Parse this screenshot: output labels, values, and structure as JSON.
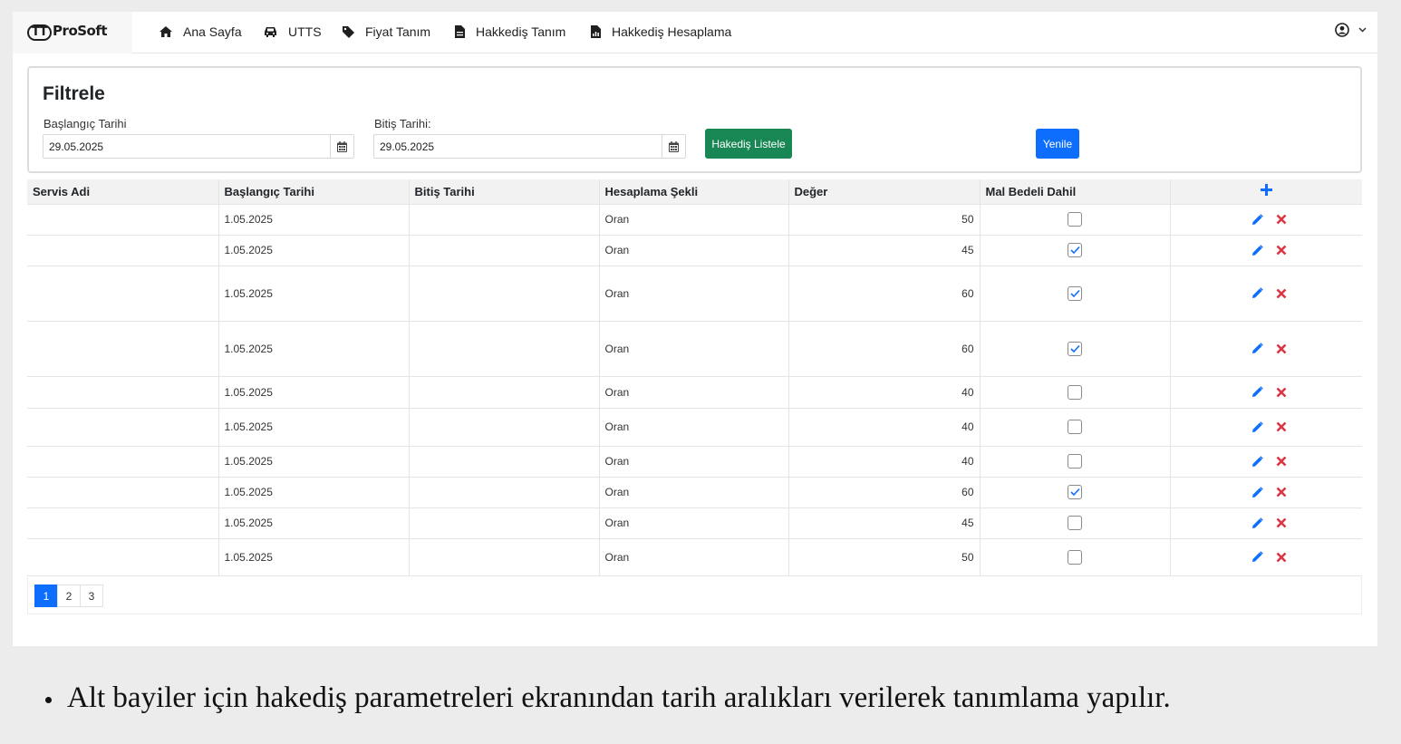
{
  "app": {
    "logo_tt": "TT",
    "logo_text": "ProSoft"
  },
  "nav": [
    {
      "label": "Ana Sayfa",
      "icon": "home-icon"
    },
    {
      "label": "UTTS",
      "icon": "car-icon"
    },
    {
      "label": "Fiyat Tanım",
      "icon": "tag-icon"
    },
    {
      "label": "Hakkediş Tanım",
      "icon": "document-icon"
    },
    {
      "label": "Hakkediş Hesaplama",
      "icon": "report-document-icon"
    }
  ],
  "filter": {
    "title": "Filtrele",
    "start_label": "Başlangıç Tarihi",
    "start_value": "29.05.2025",
    "end_label": "Bitiş Tarihi:",
    "end_value": "29.05.2025",
    "list_button": "Hakediş Listele",
    "refresh_button": "Yenile"
  },
  "table": {
    "headers": [
      "Servis Adi",
      "Başlangıç Tarihi",
      "Bitiş Tarihi",
      "Hesaplama Şekli",
      "Değer",
      "Mal Bedeli Dahil"
    ],
    "rows": [
      {
        "servis": "",
        "start": "1.05.2025",
        "end": "",
        "method": "Oran",
        "value": "50",
        "mal": false
      },
      {
        "servis": "",
        "start": "1.05.2025",
        "end": "",
        "method": "Oran",
        "value": "45",
        "mal": true
      },
      {
        "servis": "",
        "start": "1.05.2025",
        "end": "",
        "method": "Oran",
        "value": "60",
        "mal": true
      },
      {
        "servis": "",
        "start": "1.05.2025",
        "end": "",
        "method": "Oran",
        "value": "60",
        "mal": true
      },
      {
        "servis": "",
        "start": "1.05.2025",
        "end": "",
        "method": "Oran",
        "value": "40",
        "mal": false
      },
      {
        "servis": "",
        "start": "1.05.2025",
        "end": "",
        "method": "Oran",
        "value": "40",
        "mal": false
      },
      {
        "servis": "",
        "start": "1.05.2025",
        "end": "",
        "method": "Oran",
        "value": "40",
        "mal": false
      },
      {
        "servis": "",
        "start": "1.05.2025",
        "end": "",
        "method": "Oran",
        "value": "60",
        "mal": true
      },
      {
        "servis": "",
        "start": "1.05.2025",
        "end": "",
        "method": "Oran",
        "value": "45",
        "mal": false
      },
      {
        "servis": "",
        "start": "1.05.2025",
        "end": "",
        "method": "Oran",
        "value": "50",
        "mal": false
      }
    ]
  },
  "pagination": {
    "pages": [
      "1",
      "2",
      "3"
    ],
    "active": "1"
  },
  "caption": "Alt bayiler için hakediş parametreleri ekranından tarih aralıkları verilerek tanımlama yapılır.",
  "colors": {
    "primary": "#0d6efd",
    "success": "#198754",
    "danger": "#dc3545"
  }
}
